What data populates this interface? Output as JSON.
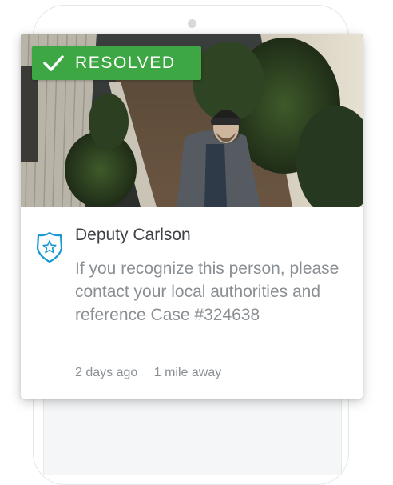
{
  "alert": {
    "status_label": "RESOLVED",
    "author": "Deputy Carlson",
    "message": "If you recognize this person, please contact your local authorities and reference Case #324638",
    "time_ago": "2 days ago",
    "distance": "1 mile away"
  },
  "colors": {
    "resolved_green": "#3da843",
    "badge_blue": "#1998d5",
    "title_text": "#3e4246",
    "body_text": "#8a8f94"
  },
  "icons": {
    "status": "checkmark-icon",
    "author": "police-badge-icon"
  }
}
